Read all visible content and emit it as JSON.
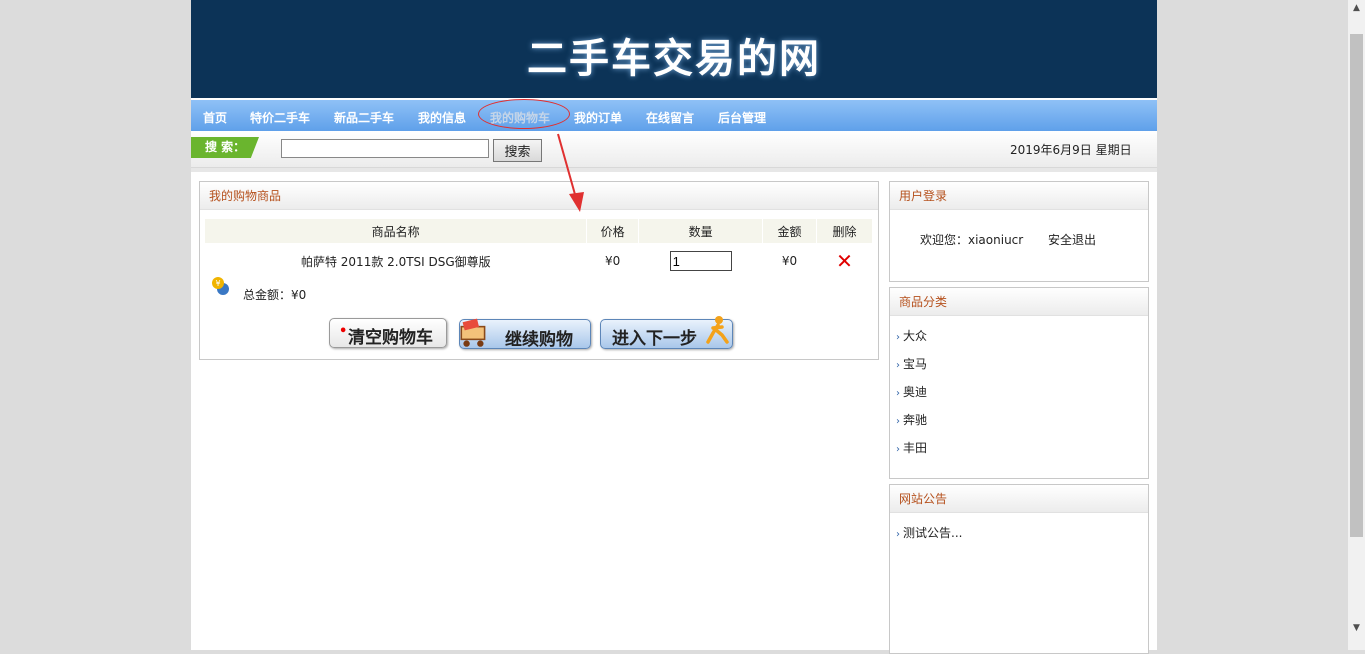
{
  "header": {
    "site_title": "二手车交易的网"
  },
  "nav": {
    "items": [
      {
        "label": "首页"
      },
      {
        "label": "特价二手车"
      },
      {
        "label": "新品二手车"
      },
      {
        "label": "我的信息"
      },
      {
        "label": "我的购物车"
      },
      {
        "label": "我的订单"
      },
      {
        "label": "在线留言"
      },
      {
        "label": "后台管理"
      }
    ],
    "active_index": 4
  },
  "search": {
    "tag_label": "搜 索：",
    "input_value": "",
    "button_label": "搜索"
  },
  "date": "2019年6月9日 星期日",
  "cart": {
    "title": "我的购物商品",
    "columns": [
      "商品名称",
      "价格",
      "数量",
      "金额",
      "删除"
    ],
    "rows": [
      {
        "name": "帕萨特 2011款 2.0TSI DSG御尊版",
        "price": "¥0",
        "quantity": "1",
        "amount": "¥0",
        "delete_icon": "red-x-icon"
      }
    ],
    "total_label": "总金额：¥0",
    "buttons": {
      "clear": "清空购物车",
      "continue": "继续购物",
      "next": "进入下一步"
    }
  },
  "login": {
    "title": "用户登录",
    "welcome": "欢迎您：xiaoniucr",
    "logout": "安全退出"
  },
  "categories": {
    "title": "商品分类",
    "items": [
      "大众",
      "宝马",
      "奥迪",
      "奔驰",
      "丰田"
    ]
  },
  "notice": {
    "title": "网站公告",
    "items": [
      "测试公告..."
    ]
  },
  "colors": {
    "banner": "#0c3357",
    "nav": "#6aa8ef",
    "panel_title": "#b5501c",
    "annotation": "#e03030",
    "search_tag": "#6ab52e"
  }
}
